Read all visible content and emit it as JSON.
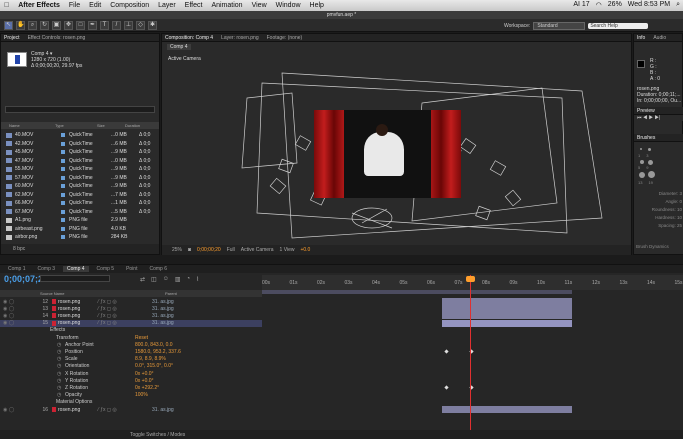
{
  "menubar": {
    "app": "After Effects",
    "items": [
      "File",
      "Edit",
      "Composition",
      "Layer",
      "Effect",
      "Animation",
      "View",
      "Window",
      "Help"
    ],
    "status": [
      "AI 17",
      "26%",
      "Wed 8:53 PM"
    ]
  },
  "titlebar": "pmvfun.aep *",
  "workspace": {
    "label": "Workspace:",
    "value": "Standard",
    "search": "Search Help"
  },
  "project": {
    "tabs": [
      "Project",
      "Effect Controls: rosen.png"
    ],
    "comp_name": "Comp 4 ▾",
    "comp_info_1": "1280 x 720 (1.00)",
    "comp_info_2": "Δ 0;00;00;20, 29.97 fps",
    "columns": [
      "Name",
      "Type",
      "Size",
      "Duration"
    ],
    "items": [
      {
        "name": "40.MOV",
        "type": "QuickTime",
        "size": "...0 MB",
        "dur": "Δ 0;0"
      },
      {
        "name": "42.MOV",
        "type": "QuickTime",
        "size": "...6 MB",
        "dur": "Δ 0;0"
      },
      {
        "name": "45.MOV",
        "type": "QuickTime",
        "size": "...9 MB",
        "dur": "Δ 0;0"
      },
      {
        "name": "47.MOV",
        "type": "QuickTime",
        "size": "...0 MB",
        "dur": "Δ 0;0"
      },
      {
        "name": "55.MOV",
        "type": "QuickTime",
        "size": "...9 MB",
        "dur": "Δ 0;0"
      },
      {
        "name": "57.MOV",
        "type": "QuickTime",
        "size": "...9 MB",
        "dur": "Δ 0;0"
      },
      {
        "name": "60.MOV",
        "type": "QuickTime",
        "size": "...9 MB",
        "dur": "Δ 0;0"
      },
      {
        "name": "62.MOV",
        "type": "QuickTime",
        "size": "...7 MB",
        "dur": "Δ 0;0"
      },
      {
        "name": "66.MOV",
        "type": "QuickTime",
        "size": "...1 MB",
        "dur": "Δ 0;0"
      },
      {
        "name": "67.MOV",
        "type": "QuickTime",
        "size": "...5 MB",
        "dur": "Δ 0;0"
      },
      {
        "name": "A1.png",
        "type": "PNG file",
        "size": "2.9 MB",
        "dur": ""
      },
      {
        "name": "airbeast.png",
        "type": "PNG file",
        "size": "4.0 KB",
        "dur": ""
      },
      {
        "name": "airbor.png",
        "type": "PNG file",
        "size": "284 KB",
        "dur": ""
      }
    ],
    "footer": "8 bpc"
  },
  "comp": {
    "tabs": [
      "Composition: Comp 4",
      "Layer: rosen.png",
      "Footage: (none)"
    ],
    "name": "Comp 4",
    "camera": "Active Camera",
    "footer": {
      "zoom": "25%",
      "timecode": "0;00;00;20",
      "res": "Full",
      "view": "Active Camera",
      "views": "1 View",
      "exposure": "+0.0"
    }
  },
  "info": {
    "tabs": [
      "Info",
      "Audio"
    ],
    "lines": [
      "R :",
      "G :",
      "B :",
      "A : 0"
    ],
    "file": [
      "rosen.png",
      "Duration: 0;00;11;...",
      "In: 0;00;00;00, Ou..."
    ],
    "preview": "Preview",
    "brushes": "Brushes",
    "brush_params": [
      "Diameter: 3",
      "Angle: 0",
      "Roundness: 10",
      "Hardness: 10",
      "Spacing: 25"
    ],
    "brush_sizes": [
      "1",
      "3",
      "5",
      "9",
      "13",
      "19"
    ],
    "footer": "Brush Dynamics"
  },
  "timeline": {
    "tabs": [
      "Comp 1",
      "Comp 3",
      "Comp 4",
      "Comp 5",
      "Point",
      "Comp 6"
    ],
    "timecode": "0;00;07;20",
    "columns": [
      "Source Name",
      "Parent"
    ],
    "ticks": [
      "00s",
      "01s",
      "02s",
      "03s",
      "04s",
      "05s",
      "06s",
      "07s",
      "08s",
      "09s",
      "10s",
      "11s",
      "12s",
      "13s",
      "14s",
      "15s"
    ],
    "layers": [
      {
        "num": "12",
        "name": "rosen.png",
        "parent": "31. as.jpg"
      },
      {
        "num": "13",
        "name": "rosen.png",
        "parent": "31. as.jpg"
      },
      {
        "num": "14",
        "name": "rosen.png",
        "parent": "31. as.jpg"
      },
      {
        "num": "15",
        "name": "rosen.png",
        "parent": "31. as.jpg"
      }
    ],
    "props": [
      {
        "name": "Effects",
        "value": ""
      },
      {
        "name": "Transform",
        "value": "Reset"
      },
      {
        "name": "Anchor Point",
        "value": "800.0, 843.0, 0.0"
      },
      {
        "name": "Position",
        "value": "1580.0, 953.2, 337.6"
      },
      {
        "name": "Scale",
        "value": "8.9, 8.9, 8.9%"
      },
      {
        "name": "Orientation",
        "value": "0.0°, 315.0°, 0.0°"
      },
      {
        "name": "X Rotation",
        "value": "0x +0.0°"
      },
      {
        "name": "Y Rotation",
        "value": "0x +0.0°"
      },
      {
        "name": "Z Rotation",
        "value": "0x +292.2°"
      },
      {
        "name": "Opacity",
        "value": "100%"
      },
      {
        "name": "Material Options",
        "value": ""
      }
    ],
    "last_layer": {
      "num": "16",
      "name": "rosen.png",
      "parent": "31. as.jpg"
    },
    "footer": "Toggle Switches / Modes"
  }
}
